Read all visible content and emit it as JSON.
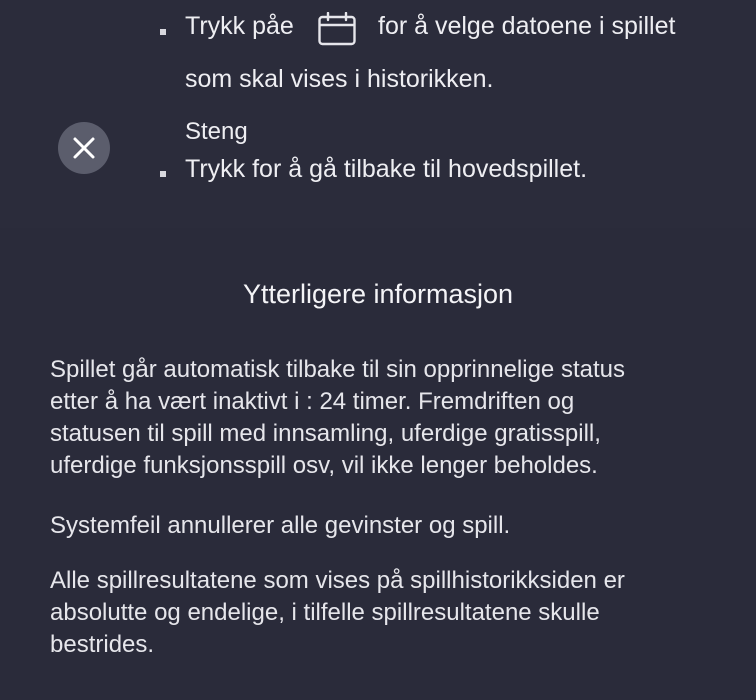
{
  "instructions": {
    "calendar": {
      "text_before": "Trykk påe",
      "icon": "calendar-icon",
      "text_after": "for å velge datoene i spillet",
      "text_line2": "som skal vises i historikken."
    },
    "close": {
      "icon": "close-icon",
      "title": "Steng",
      "description": "Trykk for å gå tilbake til hovedspillet."
    }
  },
  "additional_info": {
    "title": "Ytterligere informasjon",
    "paragraphs": [
      {
        "lines": [
          "Spillet går automatisk tilbake til sin opprinnelige status",
          "etter å ha vært inaktivt i : 24 timer. Fremdriften og",
          "statusen til spill med innsamling, uferdige gratisspill,",
          "uferdige funksjonsspill osv, vil ikke lenger beholdes."
        ]
      },
      {
        "lines": [
          "Systemfeil annullerer alle gevinster og spill."
        ]
      },
      {
        "lines": [
          "Alle spillresultatene som vises på spillhistorikksiden er",
          "absolutte og endelige, i tilfelle spillresultatene skulle",
          "bestrides."
        ]
      }
    ]
  },
  "colors": {
    "background": "#2a2b3a",
    "text": "#e9e9ee",
    "close_button_bg": "#5b5d6c"
  }
}
